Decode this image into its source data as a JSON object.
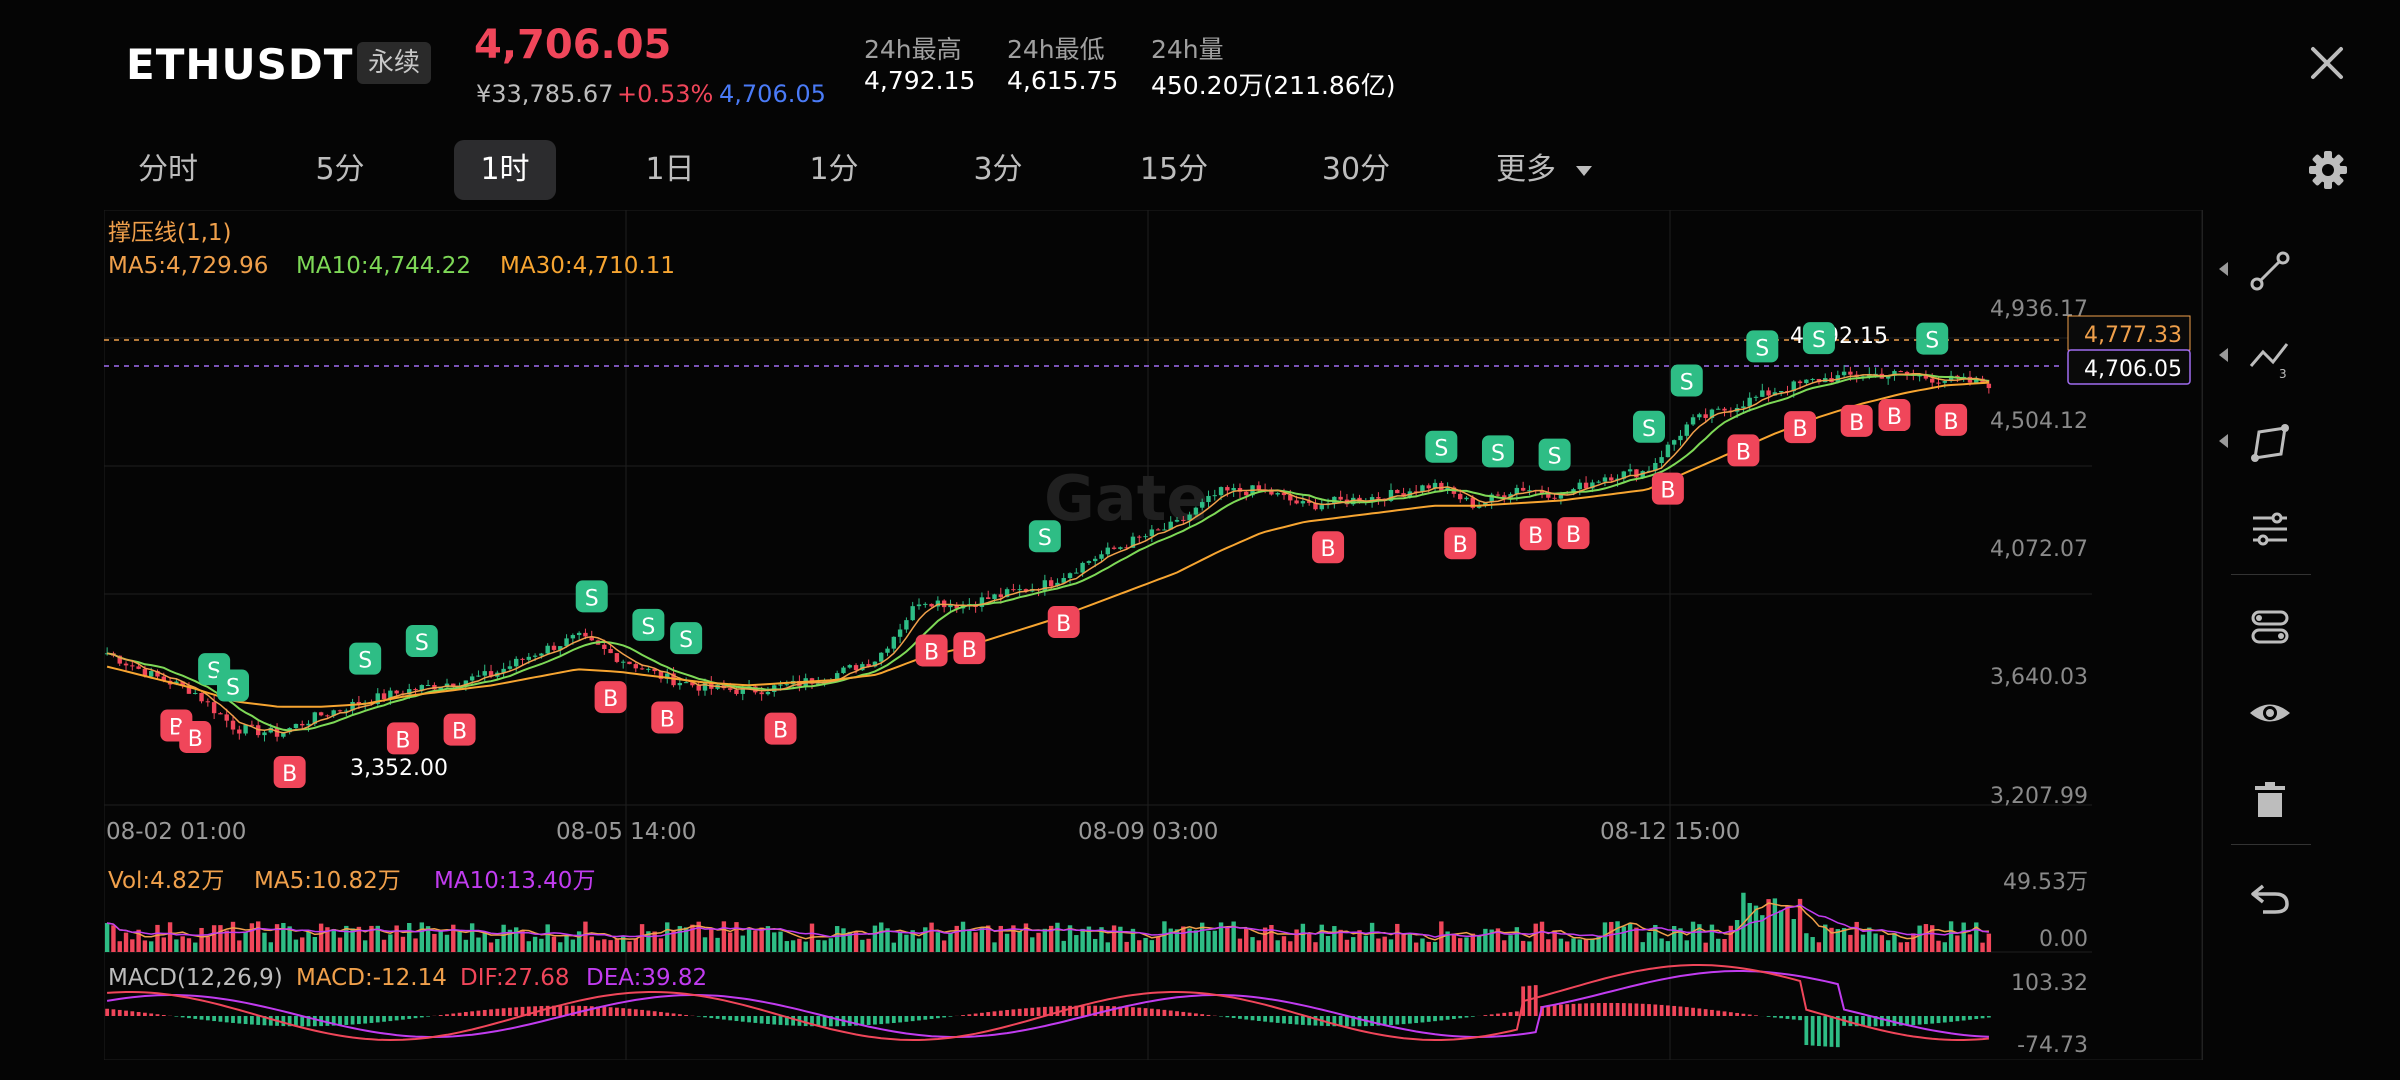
{
  "header": {
    "symbol": "ETHUSDT",
    "contract_type": "永续",
    "last_price": "4,706.05",
    "cny_price": "¥33,785.67",
    "change_pct": "+0.53%",
    "mark_price": "4,706.05",
    "stats": [
      {
        "label": "24h最高",
        "value": "4,792.15"
      },
      {
        "label": "24h最低",
        "value": "4,615.75"
      },
      {
        "label": "24h量",
        "value": "450.20万(211.86亿)"
      }
    ],
    "close_icon": "close-icon"
  },
  "tabs": [
    {
      "label": "分时",
      "active": false
    },
    {
      "label": "5分",
      "active": false
    },
    {
      "label": "1时",
      "active": true
    },
    {
      "label": "1日",
      "active": false
    },
    {
      "label": "1分",
      "active": false
    },
    {
      "label": "3分",
      "active": false
    },
    {
      "label": "15分",
      "active": false
    },
    {
      "label": "30分",
      "active": false
    },
    {
      "label": "更多",
      "active": false
    }
  ],
  "settings_icon": "gear-icon",
  "colors": {
    "up": "#2ebd85",
    "down": "#f0465a",
    "ma5": "#f0a04b",
    "ma10": "#7ed957",
    "ma30": "#f7a531",
    "vol_ma10": "#c13cf0",
    "macd_label": "#f0a04b",
    "dif": "#f0465a",
    "dea": "#c13cf0",
    "mark_blue": "#4a7bf7"
  },
  "indicators": {
    "support_resistance": "撑压线(1,1)",
    "ma5": "MA5:4,729.96",
    "ma10": "MA10:4,744.22",
    "ma30": "MA30:4,710.11",
    "vol": "Vol:4.82万",
    "vol_ma5": "MA5:10.82万",
    "vol_ma10": "MA10:13.40万",
    "macd_name": "MACD(12,26,9)",
    "macd_val": "MACD:-12.14",
    "dif": "DIF:27.68",
    "dea": "DEA:39.82"
  },
  "watermark": "Gate",
  "price_axis": [
    "4,936.17",
    "4,504.12",
    "4,072.07",
    "3,640.03",
    "3,207.99"
  ],
  "price_tags": {
    "resistance": "4,777.33",
    "last": "4,706.05",
    "max_label": "4,792.15",
    "min_label": "3,352.00"
  },
  "time_axis": [
    "08-02 01:00",
    "08-05 14:00",
    "08-09 03:00",
    "08-12 15:00"
  ],
  "volume_axis": [
    "49.53万",
    "0.00"
  ],
  "macd_axis": [
    "103.32",
    "-74.73"
  ],
  "trade_markers": {
    "buy": "B",
    "sell": "S"
  },
  "sidebar_icons": [
    "trendline-icon",
    "polyline-icon",
    "shape-icon",
    "indicator-settings-icon",
    "layout-icon",
    "eye-icon",
    "trash-icon",
    "undo-icon"
  ],
  "chart_data": [
    {
      "type": "line",
      "title": "ETHUSDT 1时",
      "x_labels": [
        "08-02 01:00",
        "08-05 14:00",
        "08-09 03:00",
        "08-12 15:00"
      ],
      "series": [
        {
          "name": "Close",
          "values": [
            3700,
            3620,
            3560,
            3420,
            3400,
            3470,
            3520,
            3560,
            3590,
            3620,
            3700,
            3760,
            3680,
            3610,
            3570,
            3560,
            3580,
            3620,
            3680,
            3900,
            3880,
            3920,
            3960,
            4050,
            4120,
            4180,
            4300,
            4310,
            4250,
            4270,
            4290,
            4330,
            4250,
            4320,
            4290,
            4360,
            4380,
            4560,
            4620,
            4680,
            4720,
            4740,
            4740,
            4720,
            4706.05
          ]
        },
        {
          "name": "MA30",
          "values": [
            3650,
            3610,
            3570,
            3520,
            3500,
            3500,
            3510,
            3540,
            3560,
            3580,
            3610,
            3640,
            3630,
            3610,
            3590,
            3580,
            3590,
            3600,
            3620,
            3680,
            3720,
            3770,
            3820,
            3880,
            3940,
            4000,
            4080,
            4150,
            4190,
            4210,
            4230,
            4250,
            4250,
            4260,
            4270,
            4290,
            4310,
            4380,
            4450,
            4520,
            4580,
            4630,
            4670,
            4700,
            4710.11
          ]
        }
      ],
      "ylim": [
        3207.99,
        4936.17
      ]
    }
  ]
}
